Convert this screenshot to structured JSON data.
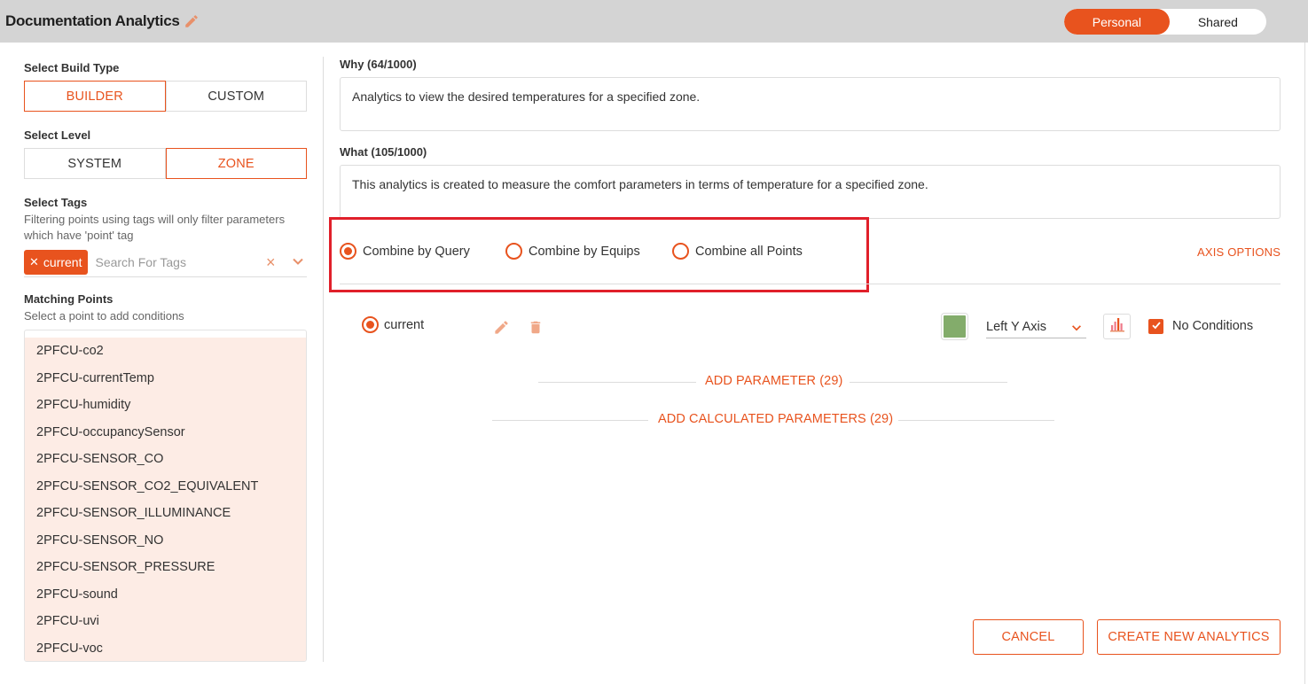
{
  "header": {
    "title": "Documentation Analytics",
    "toggle": {
      "personal": "Personal",
      "shared": "Shared",
      "active": "Personal"
    }
  },
  "left": {
    "build_type": {
      "label": "Select Build Type",
      "options": [
        "BUILDER",
        "CUSTOM"
      ],
      "selected": "BUILDER"
    },
    "level": {
      "label": "Select Level",
      "options": [
        "SYSTEM",
        "ZONE"
      ],
      "selected": "ZONE"
    },
    "tags": {
      "label": "Select Tags",
      "help": "Filtering points using tags will only filter parameters which have 'point' tag",
      "chips": [
        "current"
      ],
      "placeholder": "Search For Tags"
    },
    "matching": {
      "label": "Matching Points",
      "help": "Select a point to add conditions",
      "points": [
        "2PFCU-co2",
        "2PFCU-currentTemp",
        "2PFCU-humidity",
        "2PFCU-occupancySensor",
        "2PFCU-SENSOR_CO",
        "2PFCU-SENSOR_CO2_EQUIVALENT",
        "2PFCU-SENSOR_ILLUMINANCE",
        "2PFCU-SENSOR_NO",
        "2PFCU-SENSOR_PRESSURE",
        "2PFCU-sound",
        "2PFCU-uvi",
        "2PFCU-voc"
      ]
    }
  },
  "right": {
    "why": {
      "label": "Why (64/1000)",
      "value": "Analytics to view the desired temperatures for a specified zone."
    },
    "what": {
      "label": "What (105/1000)",
      "value": "This analytics is created to measure the comfort parameters in terms of temperature for a specified zone."
    },
    "combine": {
      "options": [
        "Combine by Query",
        "Combine by Equips",
        "Combine all Points"
      ],
      "selected": "Combine by Query"
    },
    "axis_options": "AXIS OPTIONS",
    "parameter": {
      "name": "current",
      "color": "#83ac6b",
      "axis": "Left Y Axis",
      "conditions_label": "No Conditions",
      "conditions_checked": true
    },
    "add_parameter": "ADD PARAMETER (29)",
    "add_calculated": "ADD CALCULATED PARAMETERS (29)",
    "cancel": "CANCEL",
    "create": "CREATE NEW ANALYTICS"
  },
  "colors": {
    "accent": "#e8531e",
    "highlight": "#e0202a",
    "points_bg": "#fdece5"
  },
  "icons": [
    "pencil-icon",
    "trash-icon",
    "close-icon",
    "chevron-down-icon",
    "bar-chart-icon",
    "check-icon"
  ]
}
